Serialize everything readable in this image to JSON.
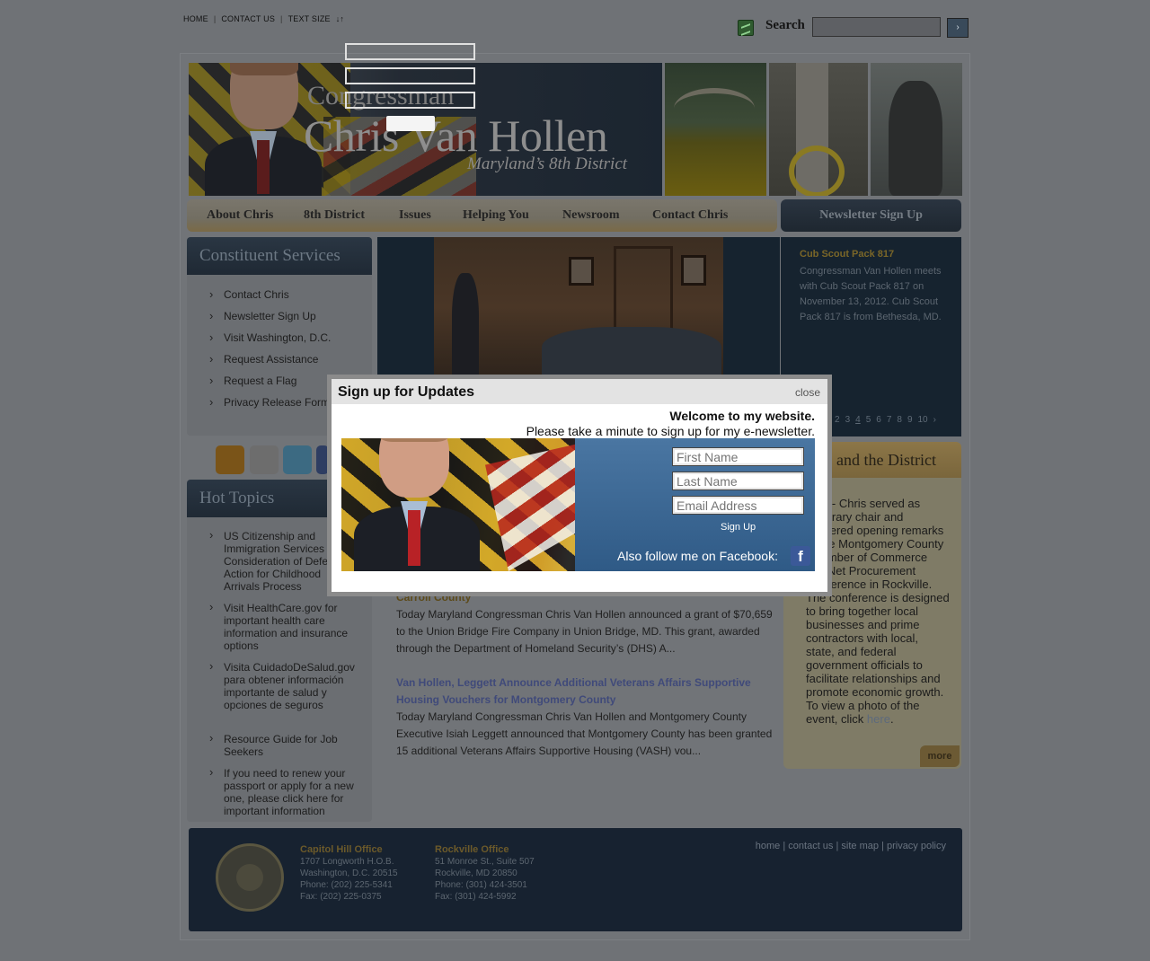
{
  "utility": {
    "home": "HOME",
    "contact": "CONTACT US",
    "text_size": "TEXT SIZE",
    "text_size_arrows": "↓↑",
    "sep": "|"
  },
  "search": {
    "label": "Search",
    "go": "›"
  },
  "banner": {
    "title_small": "Congressman",
    "title_big": "Chris Van Hollen",
    "subtitle": "Maryland’s 8th District"
  },
  "nav": {
    "items": [
      "About Chris",
      "8th District",
      "Issues",
      "Helping You",
      "Newsroom",
      "Contact Chris"
    ],
    "newsletter": "Newsletter Sign Up"
  },
  "constituent": {
    "title": "Constituent Services",
    "items": [
      "Contact Chris",
      "Newsletter Sign Up",
      "Visit Washington, D.C.",
      "Request Assistance",
      "Request a Flag",
      "Privacy Release Form"
    ]
  },
  "hot_topics": {
    "title": "Hot Topics",
    "items": [
      "US Citizenship and Immigration Services Consideration of Deferred Action for Childhood Arrivals Process",
      "Visit HealthCare.gov for important health care information and insurance options",
      "Visita CuidadoDeSalud.gov para obtener información importante de salud y opciones de seguros",
      "Resource Guide for Job Seekers",
      "If you need to renew your passport or apply for a new one, please click here for important information"
    ]
  },
  "feature": {
    "title": "Cub Scout Pack 817",
    "text": "Congressman Van Hollen meets with Cub Scout Pack 817 on November 13, 2012. Cub Scout Pack 817 is from Bethesda, MD.",
    "pages": [
      "2",
      "3",
      "4",
      "5",
      "6",
      "7",
      "8",
      "9",
      "10"
    ],
    "current_page": "4"
  },
  "chris_district": {
    "title": "and the District",
    "text": "7.13 - Chris served as honorary chair and delivered opening remarks at the Montgomery County Chamber of Commerce ConNet Procurement Conference in Rockville. The conference is designed to bring together local businesses and prime contractors with local, state, and federal government officials to facilitate relationships and promote economic growth. To view a photo of the event, click ",
    "link": "here",
    "end": ".",
    "more": "more"
  },
  "news": [
    {
      "title_tail": "Carroll County",
      "body": "Today Maryland Congressman Chris Van Hollen announced a grant of $70,659 to the Union Bridge Fire Company in Union Bridge, MD. This grant, awarded through the Department of Homeland Security’s (DHS) A..."
    },
    {
      "title": "Van Hollen, Leggett Announce Additional Veterans Affairs Supportive Housing Vouchers for Montgomery County",
      "body": "Today Maryland Congressman Chris Van Hollen and Montgomery County Executive Isiah Leggett announced that Montgomery County has been granted 15 additional Veterans Affairs Supportive Housing (VASH) vou..."
    }
  ],
  "footer": {
    "capitol": {
      "heading": "Capitol Hill Office",
      "lines": [
        "1707 Longworth H.O.B.",
        "Washington, D.C. 20515",
        "Phone: (202) 225-5341",
        "Fax: (202) 225-0375"
      ]
    },
    "rockville": {
      "heading": "Rockville Office",
      "lines": [
        "51 Monroe St., Suite 507",
        "Rockville, MD 20850",
        "Phone: (301) 424-3501",
        "Fax: (301) 424-5992"
      ]
    },
    "links": [
      "home",
      "contact us",
      "site map",
      "privacy policy"
    ]
  },
  "modal": {
    "title": "Sign up for Updates",
    "close": "close",
    "welcome_line1": "Welcome to my website.",
    "welcome_line2": "Please take a minute to sign up for my e-newsletter.",
    "first_name_placeholder": "First Name",
    "last_name_placeholder": "Last Name",
    "email_placeholder": "Email Address",
    "signup": "Sign Up",
    "follow": "Also follow me on Facebook:",
    "fb": "f"
  },
  "colors": {
    "background": "#6f7276",
    "dark_panel": "#16232f",
    "gold": "#7a6628",
    "facebook": "#3b5998"
  }
}
